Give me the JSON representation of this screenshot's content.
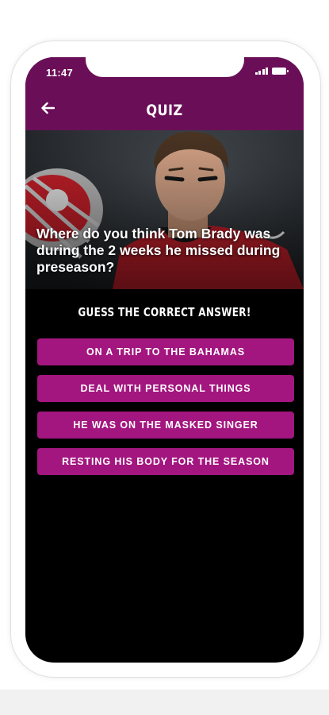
{
  "status_bar": {
    "time": "11:47"
  },
  "header": {
    "title": "QUIZ"
  },
  "hero": {
    "question": "Where do you think Tom Brady was during the 2 weeks he missed during preseason?"
  },
  "prompt": "GUESS THE CORRECT ANSWER!",
  "answers": [
    {
      "label": "ON A TRIP TO THE BAHAMAS"
    },
    {
      "label": "DEAL WITH PERSONAL THINGS"
    },
    {
      "label": "HE WAS ON THE MASKED SINGER"
    },
    {
      "label": "RESTING HIS BODY FOR THE SEASON"
    }
  ],
  "colors": {
    "header": "#6a0f57",
    "answer_button": "#a3167f",
    "background": "#000000"
  },
  "icons": {
    "back": "arrow-left-icon",
    "signal": "signal-icon",
    "battery": "battery-icon"
  }
}
